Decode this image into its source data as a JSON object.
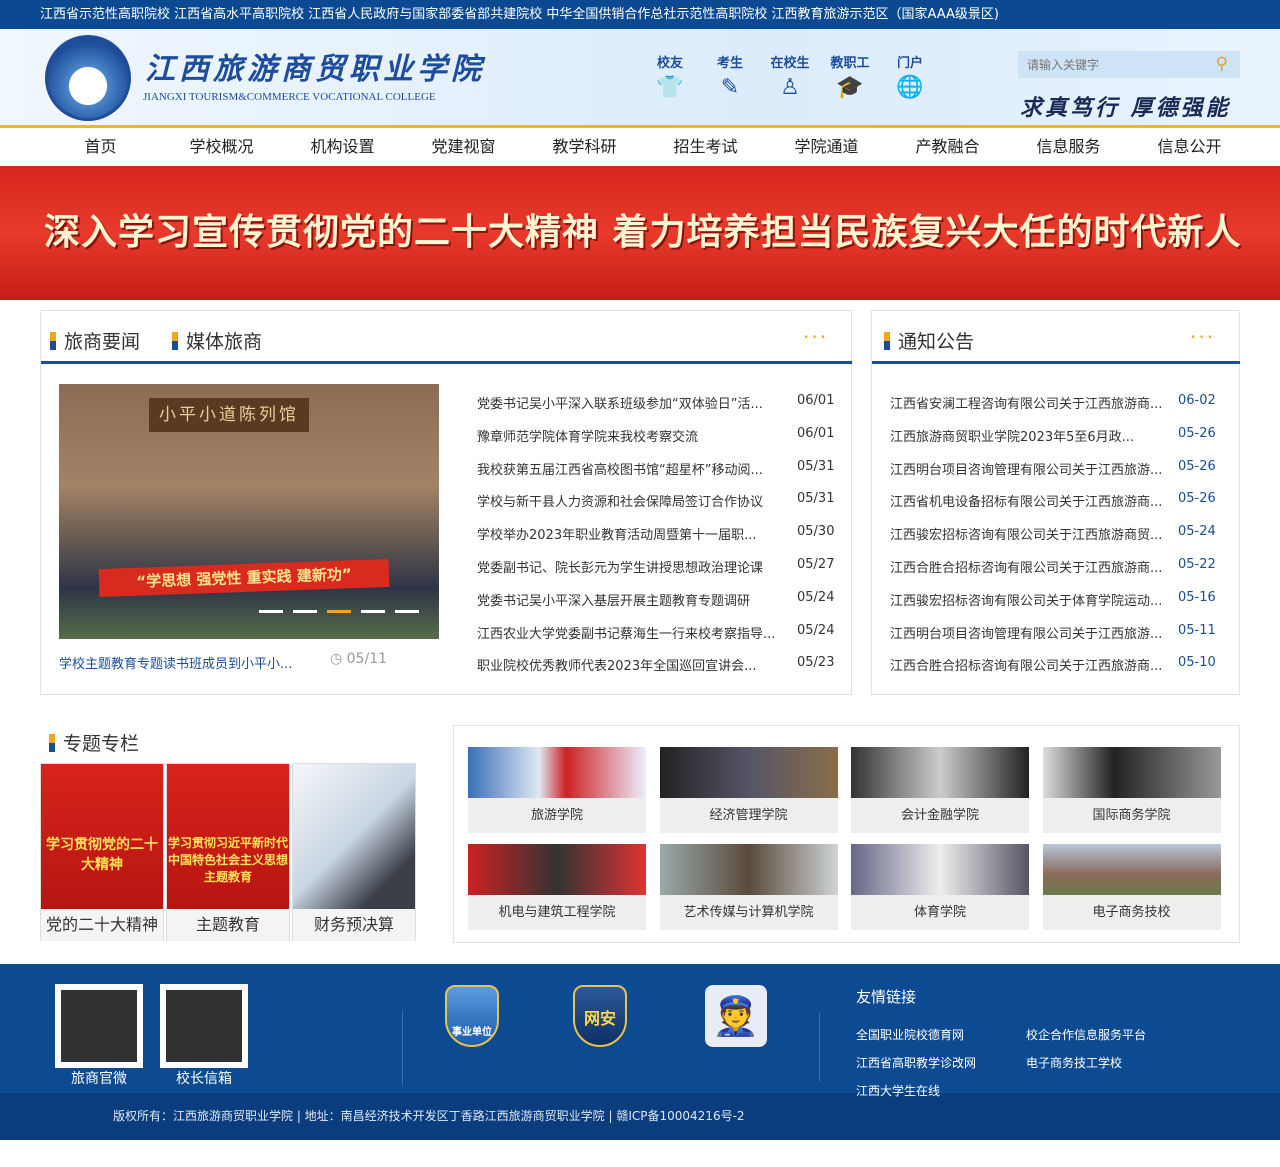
{
  "topbar": "江西省示范性高职院校 江西省高水平高职院校  江西省人民政府与国家部委省部共建院校 中华全国供销合作总社示范性高职院校 江西教育旅游示范区（国家AAA级景区)",
  "header": {
    "title": "江西旅游商贸职业学院",
    "title_en": "JIANGXI TOURISM&COMMERCE VOCATIONAL COLLEGE",
    "motto": "求真笃行 厚德强能",
    "quick": [
      {
        "label": "校友",
        "icon": "tshirt-icon"
      },
      {
        "label": "考生",
        "icon": "pencil-icon"
      },
      {
        "label": "在校生",
        "icon": "person-icon"
      },
      {
        "label": "教职工",
        "icon": "graduation-cap-icon"
      },
      {
        "label": "门户",
        "icon": "globe-icon"
      }
    ],
    "search_placeholder": "请输入关键字"
  },
  "nav": [
    "首页",
    "学校概况",
    "机构设置",
    "党建视窗",
    "教学科研",
    "招生考试",
    "学院通道",
    "产教融合",
    "信息服务",
    "信息公开"
  ],
  "banner": "深入学习宣传贯彻党的二十大精神    着力培养担当民族复兴大任的时代新人",
  "news": {
    "tabs": [
      "旅商要闻",
      "媒体旅商"
    ],
    "more": "···",
    "photo_sign": "小平小道陈列馆",
    "photo_banner": "“学思想 强党性 重实践 建新功”",
    "photo_caption": "学校主题教育专题读书班成员到小平小...",
    "photo_date": "05/11",
    "items": [
      {
        "t": "党委书记吴小平深入联系班级参加“双体验日”活...",
        "d": "06/01"
      },
      {
        "t": "豫章师范学院体育学院来我校考察交流",
        "d": "06/01"
      },
      {
        "t": "我校获第五届江西省高校图书馆“超星杯”移动阅...",
        "d": "05/31"
      },
      {
        "t": "学校与新干县人力资源和社会保障局签订合作协议",
        "d": "05/31"
      },
      {
        "t": "学校举办2023年职业教育活动周暨第十一届职...",
        "d": "05/30"
      },
      {
        "t": "党委副书记、院长彭元为学生讲授思想政治理论课",
        "d": "05/27"
      },
      {
        "t": "党委书记吴小平深入基层开展主题教育专题调研",
        "d": "05/24"
      },
      {
        "t": "江西农业大学党委副书记蔡海生一行来校考察指导...",
        "d": "05/24"
      },
      {
        "t": "职业院校优秀教师代表2023年全国巡回宣讲会...",
        "d": "05/23"
      }
    ]
  },
  "notices": {
    "title": "通知公告",
    "more": "···",
    "items": [
      {
        "t": "江西省安澜工程咨询有限公司关于江西旅游商...",
        "d": "06-02"
      },
      {
        "t": "江西旅游商贸职业学院2023年5至6月政...",
        "d": "05-26"
      },
      {
        "t": "江西明台项目咨询管理有限公司关于江西旅游...",
        "d": "05-26"
      },
      {
        "t": "江西省机电设备招标有限公司关于江西旅游商...",
        "d": "05-26"
      },
      {
        "t": "江西骏宏招标咨询有限公司关于江西旅游商贸...",
        "d": "05-24"
      },
      {
        "t": "江西合胜合招标咨询有限公司关于江西旅游商...",
        "d": "05-22"
      },
      {
        "t": "江西骏宏招标咨询有限公司关于体育学院运动...",
        "d": "05-16"
      },
      {
        "t": "江西明台项目咨询管理有限公司关于江西旅游...",
        "d": "05-11"
      },
      {
        "t": "江西合胜合招标咨询有限公司关于江西旅游商...",
        "d": "05-10"
      }
    ]
  },
  "topics": {
    "title": "专题专栏",
    "items": [
      {
        "label": "党的二十大精神",
        "img": "学习贯彻党的二十大精神"
      },
      {
        "label": "主题教育",
        "img": "学习贯彻习近平新时代中国特色社会主义思想主题教育"
      },
      {
        "label": "财务预决算",
        "img": ""
      }
    ]
  },
  "colleges": [
    "旅游学院",
    "经济管理学院",
    "会计金融学院",
    "国际商务学院",
    "机电与建筑工程学院",
    "艺术传媒与计算机学院",
    "体育学院",
    "电子商务技校"
  ],
  "footer": {
    "qr": [
      "旅商官微",
      "校长信箱"
    ],
    "badges": [
      "事业单位",
      "网安"
    ],
    "links_title": "友情链接",
    "links": [
      "全国职业院校德育网",
      "校企合作信息服务平台",
      "江西省高职教学诊改网",
      "电子商务技工学校",
      "江西大学生在线"
    ],
    "copyright": "版权所有：江西旅游商贸职业学院 | 地址：南昌经济技术开发区丁香路江西旅游商贸职业学院 | 赣ICP备10004216号-2"
  }
}
